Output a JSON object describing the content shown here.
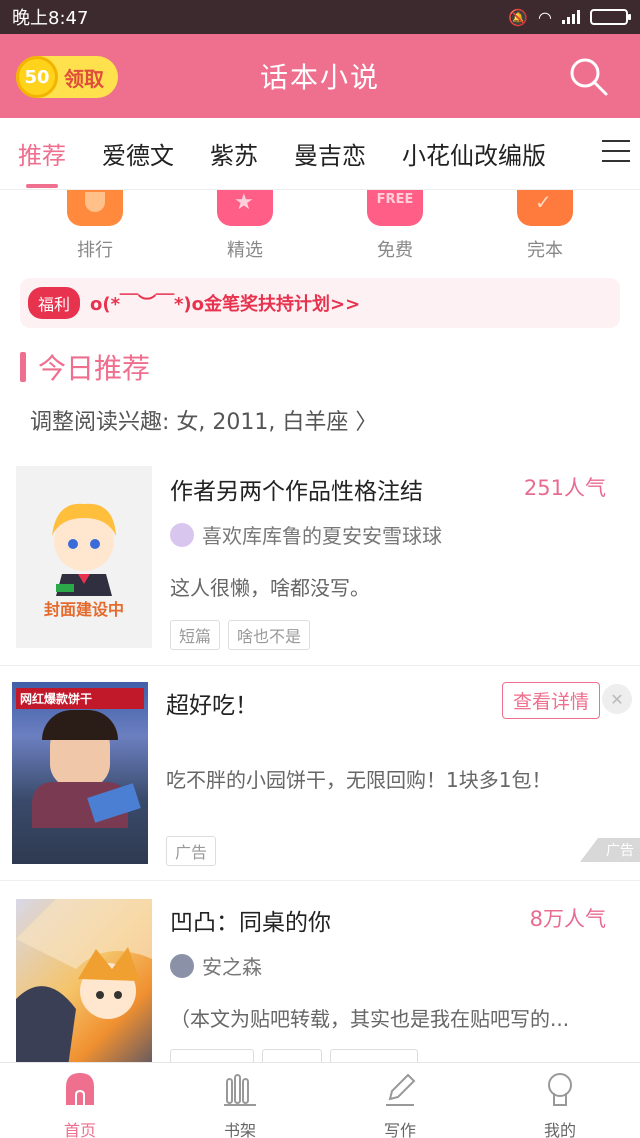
{
  "status": {
    "time": "晚上8:47"
  },
  "header": {
    "coins": "50",
    "claim_label": "领取",
    "title": "话本小说"
  },
  "tabs": [
    "推荐",
    "爱德文",
    "紫苏",
    "曼吉恋",
    "小花仙改编版"
  ],
  "quick_links": [
    {
      "label": "排行",
      "color": "#ff8a3d"
    },
    {
      "label": "精选",
      "color": "#ff5f86"
    },
    {
      "label": "免费",
      "color": "#ff5f86",
      "badge": "FREE"
    },
    {
      "label": "完本",
      "color": "#ff7a3d"
    }
  ],
  "notice": {
    "tag": "福利",
    "text": "o(*￣︶￣*)o金笔奖扶持计划>>"
  },
  "section": {
    "title": "今日推荐",
    "interest": "调整阅读兴趣: 女, 2011, 白羊座 〉"
  },
  "books": [
    {
      "title": "作者另两个作品性格注结",
      "popularity": "251人气",
      "author": "喜欢库库鲁的夏安安雪球球",
      "desc": "这人很懒，啥都没写。",
      "tags": [
        "短篇",
        "啥也不是"
      ],
      "cover_text": "封面建设中"
    },
    {
      "title": "凹凸：同桌的你",
      "popularity": "8万人气",
      "author": "安之森",
      "desc": "（本文为贴吧转载，其实也是我在贴吧写的..."
    }
  ],
  "ad": {
    "title": "超好吃！",
    "detail_label": "查看详情",
    "desc": "吃不胖的小园饼干，无限回购！1块多1包！",
    "tag": "广告",
    "mark": "广告",
    "banner_text": "网红爆款饼干"
  },
  "bottom_nav": [
    {
      "label": "首页",
      "icon": "home-icon"
    },
    {
      "label": "书架",
      "icon": "bookshelf-icon"
    },
    {
      "label": "写作",
      "icon": "pen-icon"
    },
    {
      "label": "我的",
      "icon": "user-icon"
    }
  ],
  "colors": {
    "primary": "#ef6f8e",
    "accent_red": "#e8334f",
    "coin": "#ffd21c"
  }
}
